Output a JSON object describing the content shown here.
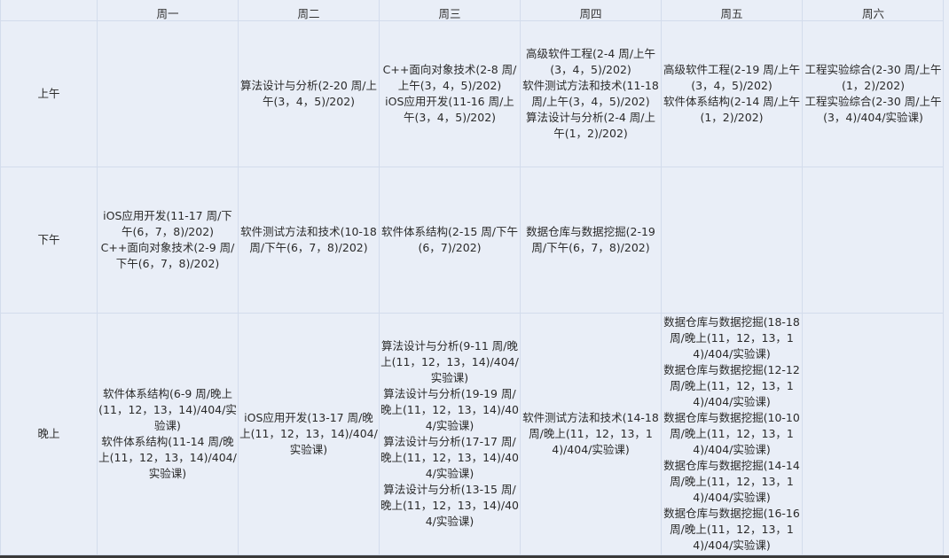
{
  "schedule": {
    "days": [
      "周一",
      "周二",
      "周三",
      "周四",
      "周五",
      "周六"
    ],
    "rows": [
      {
        "label": "上午",
        "cells": [
          [],
          [
            "算法设计与分析(2-20 周/上午(3，4，5)/202)"
          ],
          [
            "C++面向对象技术(2-8 周/上午(3，4，5)/202)",
            "iOS应用开发(11-16 周/上午(3，4，5)/202)"
          ],
          [
            "高级软件工程(2-4 周/上午(3，4，5)/202)",
            "软件测试方法和技术(11-18 周/上午(3，4，5)/202)",
            "算法设计与分析(2-4 周/上午(1，2)/202)"
          ],
          [
            "高级软件工程(2-19 周/上午(3，4，5)/202)",
            "软件体系结构(2-14 周/上午(1，2)/202)"
          ],
          [
            "工程实验综合(2-30 周/上午(1，2)/202)",
            "工程实验综合(2-30 周/上午(3，4)/404/实验课)"
          ]
        ]
      },
      {
        "label": "下午",
        "cells": [
          [
            "iOS应用开发(11-17 周/下午(6，7，8)/202)",
            "C++面向对象技术(2-9 周/下午(6，7，8)/202)"
          ],
          [
            "软件测试方法和技术(10-18 周/下午(6，7，8)/202)"
          ],
          [
            "软件体系结构(2-15 周/下午(6，7)/202)"
          ],
          [
            "数据仓库与数据挖掘(2-19 周/下午(6，7，8)/202)"
          ],
          [],
          []
        ]
      },
      {
        "label": "晚上",
        "cells": [
          [
            "软件体系结构(6-9 周/晚上(11，12，13，14)/404/实验课)",
            "软件体系结构(11-14 周/晚上(11，12，13，14)/404/实验课)"
          ],
          [
            "iOS应用开发(13-17 周/晚上(11，12，13，14)/404/实验课)"
          ],
          [
            "算法设计与分析(9-11 周/晚上(11，12，13，14)/404/实验课)",
            "算法设计与分析(19-19 周/晚上(11，12，13，14)/404/实验课)",
            "算法设计与分析(17-17 周/晚上(11，12，13，14)/404/实验课)",
            "算法设计与分析(13-15 周/晚上(11，12，13，14)/404/实验课)"
          ],
          [
            "软件测试方法和技术(14-18 周/晚上(11，12，13，14)/404/实验课)"
          ],
          [
            "数据仓库与数据挖掘(18-18 周/晚上(11，12，13，14)/404/实验课)",
            "数据仓库与数据挖掘(12-12 周/晚上(11，12，13，14)/404/实验课)",
            "数据仓库与数据挖掘(10-10 周/晚上(11，12，13，14)/404/实验课)",
            "数据仓库与数据挖掘(14-14 周/晚上(11，12，13，14)/404/实验课)",
            "数据仓库与数据挖掘(16-16 周/晚上(11，12，13，14)/404/实验课)"
          ],
          []
        ]
      }
    ]
  }
}
